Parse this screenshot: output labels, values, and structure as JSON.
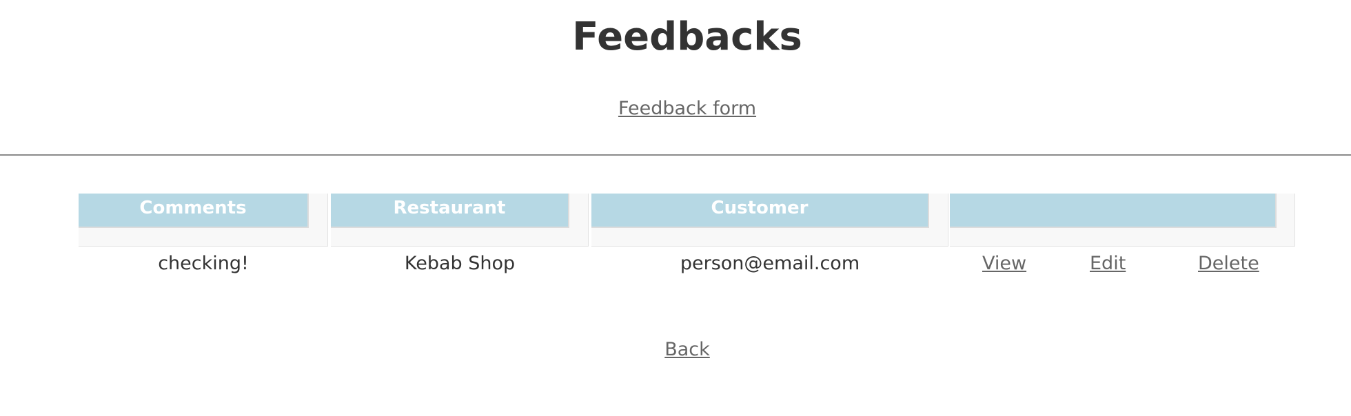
{
  "page": {
    "title": "Feedbacks",
    "feedback_form_link": "Feedback form",
    "back_link": "Back"
  },
  "table": {
    "headers": [
      "Comments",
      "Restaurant",
      "Customer",
      ""
    ],
    "rows": [
      {
        "comments": "checking!",
        "restaurant": "Kebab Shop",
        "customer": "person@email.com",
        "actions": [
          "View",
          "Edit",
          "Delete"
        ]
      }
    ]
  },
  "colors": {
    "header_background": "#b6d8e4",
    "header_text": "#ffffff",
    "link": "#666666",
    "text": "#333333"
  }
}
